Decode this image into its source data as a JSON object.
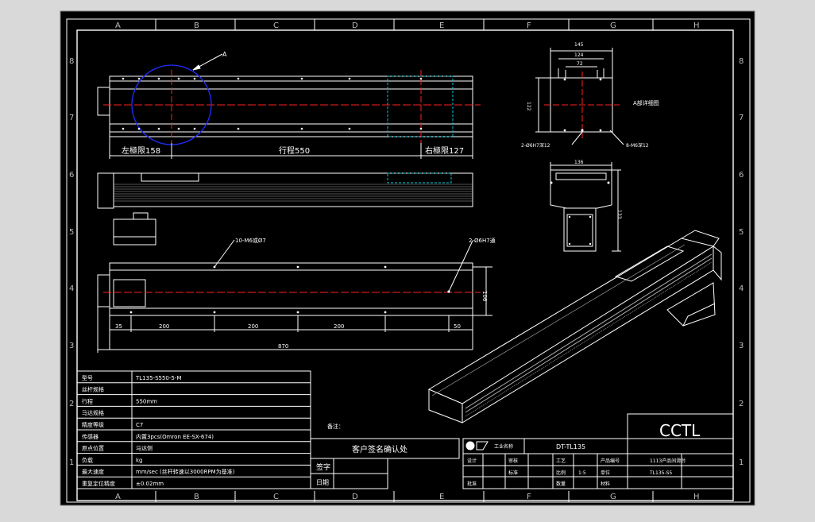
{
  "grid": {
    "columns": [
      "A",
      "B",
      "C",
      "D",
      "E",
      "F",
      "G",
      "H"
    ],
    "rows": [
      "8",
      "7",
      "6",
      "5",
      "4",
      "3",
      "2",
      "1"
    ]
  },
  "top_view": {
    "callout_a": "A",
    "left_limit": "左極限158",
    "stroke": "行程550",
    "right_limit": "右極限127"
  },
  "end_view": {
    "dim_145": "145",
    "dim_124": "124",
    "dim_72": "72",
    "dim_122": "122",
    "detail_label": "A部详细图",
    "hole_note_left": "2-Ø6H7深12",
    "hole_note_right": "8-M6深12"
  },
  "section_view": {
    "dim_136": "136",
    "dim_133": "133"
  },
  "bottom_view": {
    "hole_note_left": "10-M6或Ø7",
    "hole_note_right": "2-Ø6H7通",
    "dim_35": "35",
    "dim_200_a": "200",
    "dim_200_b": "200",
    "dim_200_c": "200",
    "dim_50": "50",
    "dim_870": "870",
    "dim_106": "106"
  },
  "spec_table": {
    "rows": [
      {
        "label": "型号",
        "value": "TL135-S550-5-M"
      },
      {
        "label": "丝杆规格",
        "value": ""
      },
      {
        "label": "行程",
        "value": "550mm"
      },
      {
        "label": "马达规格",
        "value": ""
      },
      {
        "label": "精度等级",
        "value": "C7"
      },
      {
        "label": "传感器",
        "value": "内置3pcs(Omron EE-SX-674)"
      },
      {
        "label": "原点位置",
        "value": "马达侧"
      },
      {
        "label": "负载",
        "value": "kg"
      },
      {
        "label": "最大速度",
        "value": "mm/sec (丝杆转速以3000RPM为基准)"
      },
      {
        "label": "重复定位精度",
        "value": "±0.02mm"
      }
    ]
  },
  "notes_label": "备注：",
  "confirm_label": "客户签名确认处",
  "sign_label": "签字",
  "date_label": "日期",
  "title_block": {
    "company_logo_text": "工业名称",
    "drawing_no": "DT-TL135",
    "brand": "CCTL",
    "product_name": "1113产品间滑台",
    "product_code": "TL135-S5",
    "design": "设计",
    "check": "审核",
    "approve": "批准",
    "scale": "比例",
    "scale_value": "1:5",
    "unit": "单位",
    "unit_value": "mm",
    "process": "工艺",
    "standard": "标准",
    "material": "材料",
    "quantity": "数量",
    "drawing_code": "产品编号"
  },
  "colors": {
    "background": "#000000",
    "outer": "#d9d9d9",
    "line": "#ffffff",
    "centerline": "#ff2020",
    "circle": "#1f2dff",
    "cyan_dashed": "#00c8d8"
  }
}
